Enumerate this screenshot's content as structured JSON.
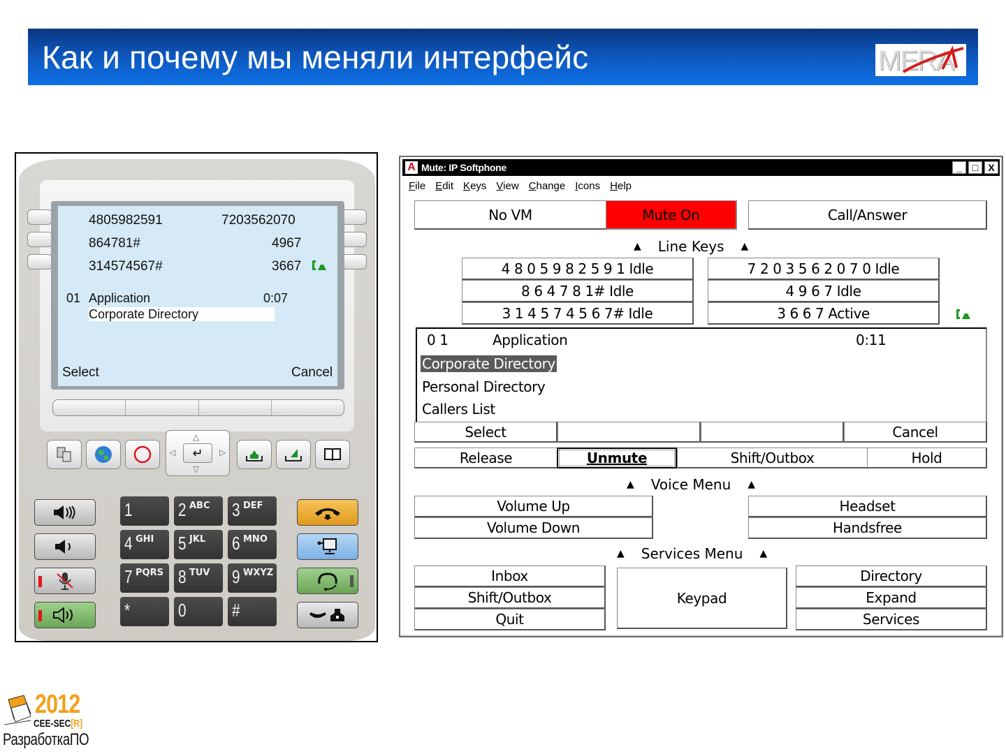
{
  "slide": {
    "title": "Как и почему мы меняли интерфейс",
    "company_logo": "MERA",
    "footer_logo": {
      "year": "2012",
      "name": "CEE-SEC",
      "name_suffix": "[R]",
      "subtitle": "РазработкаПО"
    },
    "colors": {
      "banner_dark": "#05337d",
      "banner_light": "#0a6ee6",
      "logo_accent": "#f2a01c",
      "mute_red": "#ff0000",
      "active_green": "#1a9a1a"
    }
  },
  "hardphone": {
    "lines": [
      {
        "left": "4805982591",
        "right": "7203562070",
        "icon": ""
      },
      {
        "left": "864781#",
        "right": "4967",
        "icon": ""
      },
      {
        "left": "314574567#",
        "right": "3667",
        "icon": "active-call-icon"
      }
    ],
    "call": {
      "index": "01",
      "label": "Application",
      "timer": "0:07",
      "selected_item": "Corporate Directory"
    },
    "softkeys": {
      "left": "Select",
      "right": "Cancel"
    },
    "feature_buttons": [
      "contacts-icon",
      "globe-icon",
      "stop-icon",
      "navigation-pad",
      "inbox-icon",
      "outbox-icon",
      "directory-book-icon"
    ],
    "left_buttons": [
      "volume-up-icon",
      "volume-down-icon",
      "mute-mic-icon",
      "speaker-icon"
    ],
    "keypad": [
      {
        "digit": "1",
        "letters": ""
      },
      {
        "digit": "2",
        "letters": "ABC"
      },
      {
        "digit": "3",
        "letters": "DEF"
      },
      {
        "digit": "4",
        "letters": "GHI"
      },
      {
        "digit": "5",
        "letters": "JKL"
      },
      {
        "digit": "6",
        "letters": "MNO"
      },
      {
        "digit": "7",
        "letters": "PQRS"
      },
      {
        "digit": "8",
        "letters": "TUV"
      },
      {
        "digit": "9",
        "letters": "WXYZ"
      },
      {
        "digit": "*",
        "letters": ""
      },
      {
        "digit": "0",
        "letters": ""
      },
      {
        "digit": "#",
        "letters": ""
      }
    ],
    "right_buttons": [
      "release-handset-icon",
      "conference-screen-icon",
      "headset-icon",
      "handset-phone-icon"
    ]
  },
  "softphone": {
    "window_title": "Mute: IP Softphone",
    "window_controls": {
      "minimize": "_",
      "maximize": "□",
      "close": "X"
    },
    "menu": [
      "File",
      "Edit",
      "Keys",
      "View",
      "Change",
      "Icons",
      "Help"
    ],
    "top_buttons": {
      "vm": "No VM",
      "mute": "Mute On",
      "call": "Call/Answer"
    },
    "line_keys_label": "Line Keys",
    "line_keys": [
      "4 8 0 5 9 8 2 5 9 1 Idle",
      "7 2 0 3 5 6 2 0 7 0 Idle",
      "8 6 4 7 8 1# Idle",
      "4 9 6 7 Idle",
      "3 1 4 5 7 4 5 6 7# Idle",
      "3 6 6 7 Active"
    ],
    "display": {
      "index": "0 1",
      "label": "Application",
      "timer": "0:11",
      "items": [
        "Corporate Directory",
        "Personal Directory",
        "Callers List"
      ],
      "selected_index": 0
    },
    "softkeys": [
      "Select",
      "",
      "",
      "Cancel"
    ],
    "call_buttons": [
      "Release",
      "Unmute",
      "Shift/Outbox",
      "Hold"
    ],
    "voice_menu_label": "Voice Menu",
    "voice_buttons": {
      "volume_up": "Volume Up",
      "volume_down": "Volume Down",
      "headset": "Headset",
      "handsfree": "Handsfree"
    },
    "services_menu_label": "Services Menu",
    "services_buttons": {
      "inbox": "Inbox",
      "shift_outbox": "Shift/Outbox",
      "quit": "Quit",
      "keypad": "Keypad",
      "directory": "Directory",
      "expand": "Expand",
      "services": "Services"
    }
  }
}
